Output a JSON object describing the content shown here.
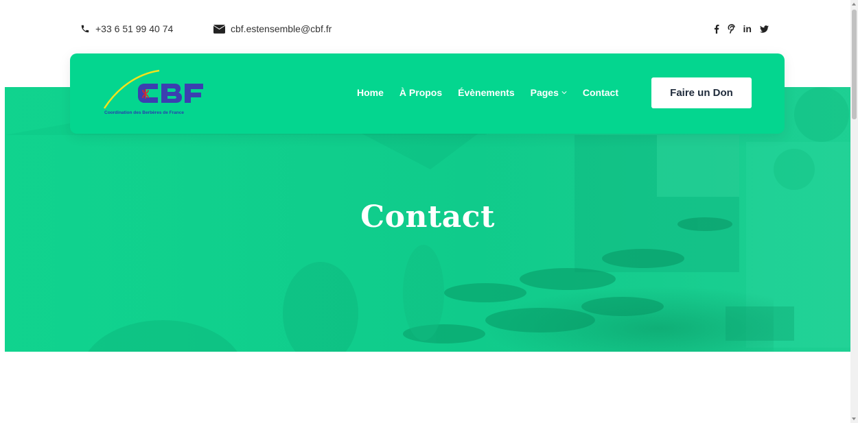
{
  "topbar": {
    "phone": "+33 6 51 99 40 74",
    "email": "cbf.estensemble@cbf.fr",
    "socials": [
      {
        "icon": "facebook-icon",
        "glyph": "f"
      },
      {
        "icon": "pinterest-icon",
        "glyph": "℗"
      },
      {
        "icon": "linkedin-icon",
        "glyph": "in"
      },
      {
        "icon": "twitter-icon",
        "glyph": "🐦"
      }
    ]
  },
  "logo": {
    "text": "CBF",
    "caption": "Coordination des Berbères de France"
  },
  "nav": {
    "items": [
      {
        "label": "Home"
      },
      {
        "label": "À Propos"
      },
      {
        "label": "Évènements"
      },
      {
        "label": "Pages"
      },
      {
        "label": "Contact"
      }
    ],
    "cta": "Faire un Don"
  },
  "hero": {
    "title": "Contact"
  },
  "colors": {
    "brand_green": "#04d68f",
    "logo_blue": "#3b3fb0",
    "logo_yellow": "#f2e21d",
    "text_dark": "#1e2a3a"
  }
}
